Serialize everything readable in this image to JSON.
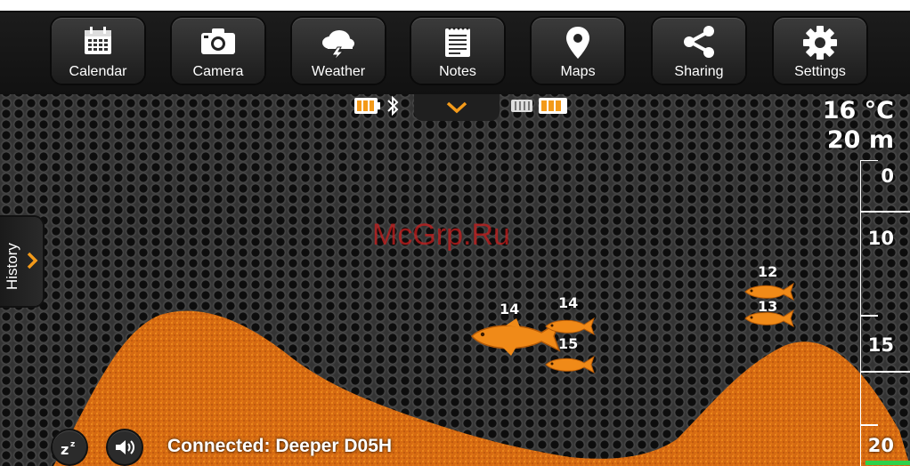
{
  "menu": {
    "items": [
      {
        "label": "Calendar",
        "icon": "calendar-icon"
      },
      {
        "label": "Camera",
        "icon": "camera-icon"
      },
      {
        "label": "Weather",
        "icon": "weather-icon"
      },
      {
        "label": "Notes",
        "icon": "notes-icon"
      },
      {
        "label": "Maps",
        "icon": "map-pin-icon"
      },
      {
        "label": "Sharing",
        "icon": "share-icon"
      },
      {
        "label": "Settings",
        "icon": "gear-icon"
      }
    ]
  },
  "status": {
    "phone_battery_icon": "phone-battery-icon",
    "bluetooth_icon": "bluetooth-icon",
    "device_battery_icon": "device-battery-icon",
    "pull_down_icon": "chevron-down-icon"
  },
  "readout": {
    "temperature": "16 °C",
    "depth": "20 m"
  },
  "depth_scale": {
    "labels": [
      "0",
      "10",
      "15",
      "20"
    ]
  },
  "history": {
    "label": "History",
    "icon": "chevron-right-icon"
  },
  "fish": [
    {
      "depth_label": "14",
      "size": "large"
    },
    {
      "depth_label": "14",
      "size": "small"
    },
    {
      "depth_label": "15",
      "size": "small"
    },
    {
      "depth_label": "12",
      "size": "small"
    },
    {
      "depth_label": "13",
      "size": "small"
    }
  ],
  "watermark": "McGrp.Ru",
  "bottom_bar": {
    "sleep_icon": "sleep-icon",
    "sound_icon": "speaker-icon",
    "connection_status": "Connected: Deeper D05H"
  },
  "colors": {
    "accent": "#f39a1a",
    "bottom_fill": "#d96d10",
    "active_indicator": "#2fd14a"
  }
}
